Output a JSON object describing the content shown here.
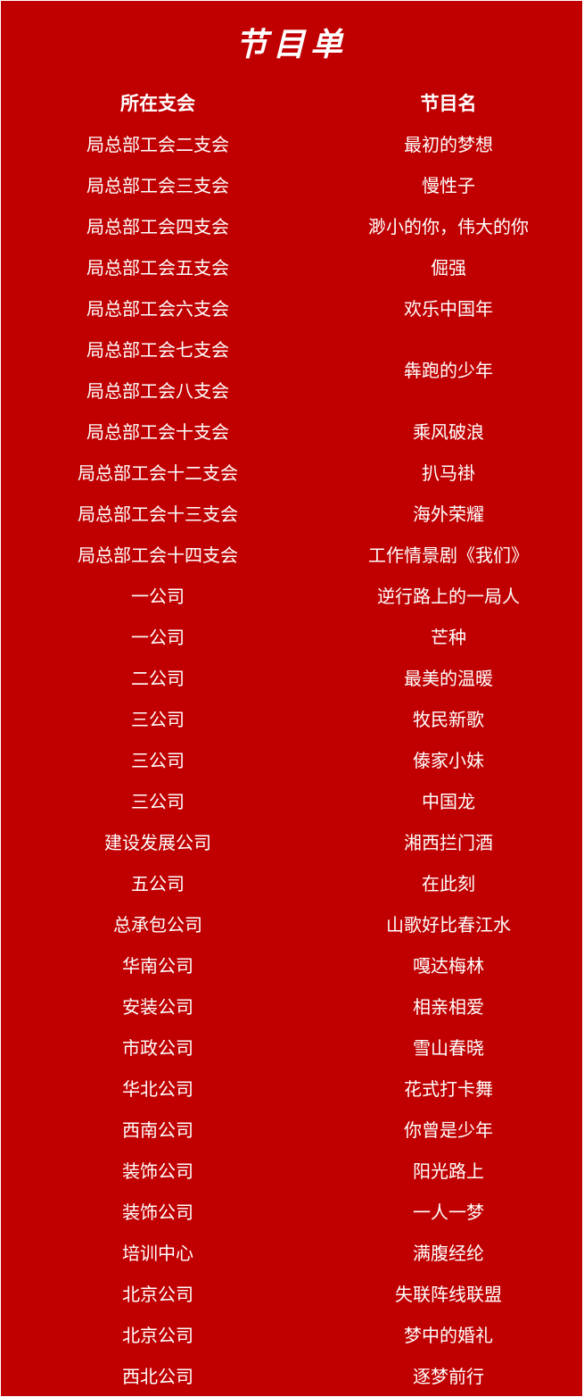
{
  "title": "节目单",
  "headers": {
    "branch": "所在支会",
    "program": "节目名"
  },
  "rows": [
    {
      "branch": "局总部工会二支会",
      "program": "最初的梦想"
    },
    {
      "branch": "局总部工会三支会",
      "program": "慢性子"
    },
    {
      "branch": "局总部工会四支会",
      "program": "渺小的你，伟大的你"
    },
    {
      "branch": "局总部工会五支会",
      "program": "倔强"
    },
    {
      "branch": "局总部工会六支会",
      "program": "欢乐中国年"
    },
    {
      "branch": "局总部工会七支会",
      "program": "犇跑的少年"
    },
    {
      "branch": "局总部工会八支会",
      "program": ""
    },
    {
      "branch": "局总部工会十支会",
      "program": "乘风破浪"
    },
    {
      "branch": "局总部工会十二支会",
      "program": "扒马褂"
    },
    {
      "branch": "局总部工会十三支会",
      "program": "海外荣耀"
    },
    {
      "branch": "局总部工会十四支会",
      "program": "工作情景剧《我们》"
    },
    {
      "branch": "一公司",
      "program": "逆行路上的一局人"
    },
    {
      "branch": "一公司",
      "program": "芒种"
    },
    {
      "branch": "二公司",
      "program": "最美的温暖"
    },
    {
      "branch": "三公司",
      "program": "牧民新歌"
    },
    {
      "branch": "三公司",
      "program": "傣家小妹"
    },
    {
      "branch": "三公司",
      "program": "中国龙"
    },
    {
      "branch": "建设发展公司",
      "program": "湘西拦门酒"
    },
    {
      "branch": "五公司",
      "program": "在此刻"
    },
    {
      "branch": "总承包公司",
      "program": "山歌好比春江水"
    },
    {
      "branch": "华南公司",
      "program": "嘎达梅林"
    },
    {
      "branch": "安装公司",
      "program": "相亲相爱"
    },
    {
      "branch": "市政公司",
      "program": "雪山春晓"
    },
    {
      "branch": "华北公司",
      "program": "花式打卡舞"
    },
    {
      "branch": "西南公司",
      "program": "你曾是少年"
    },
    {
      "branch": "装饰公司",
      "program": "阳光路上"
    },
    {
      "branch": "装饰公司",
      "program": "一人一梦"
    },
    {
      "branch": "培训中心",
      "program": "满腹经纶"
    },
    {
      "branch": "北京公司",
      "program": "失联阵线联盟"
    },
    {
      "branch": "北京公司",
      "program": "梦中的婚礼"
    },
    {
      "branch": "西北公司",
      "program": "逐梦前行"
    }
  ]
}
